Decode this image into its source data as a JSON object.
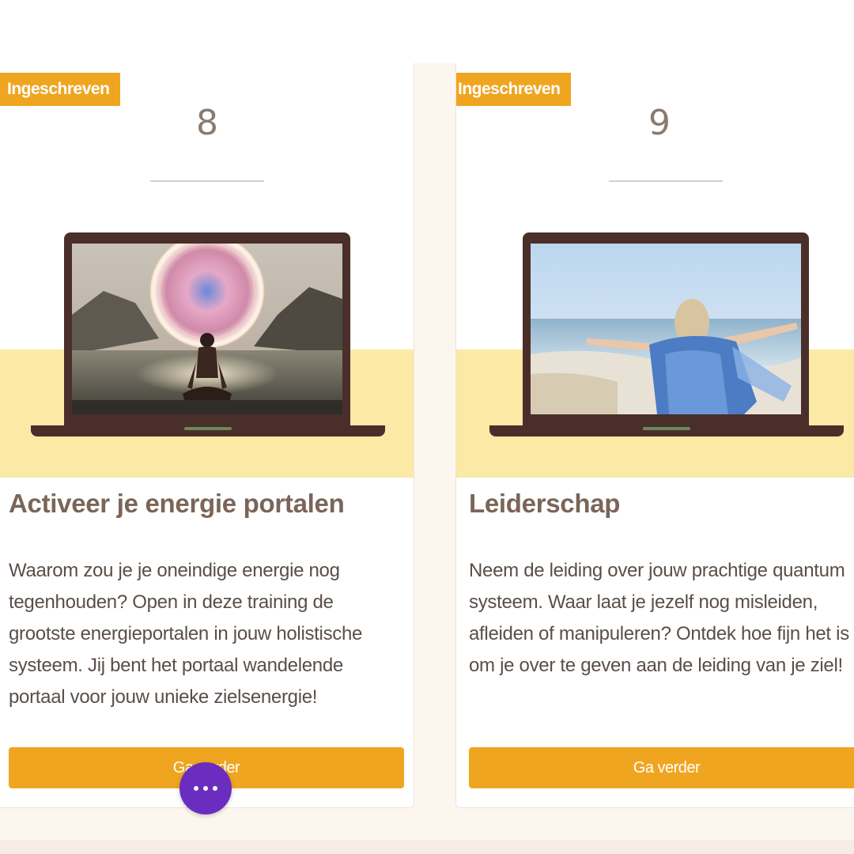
{
  "colors": {
    "accent": "#f0a520",
    "band": "#fbe9a6",
    "fab": "#6b2cc0",
    "title_text": "#7a6558"
  },
  "cards": [
    {
      "badge": "Ingeschreven",
      "number": "8",
      "image": "meditation-energy-portal-image",
      "title": "Activeer je energie portalen",
      "description": "Waarom zou je je oneindige energie nog tegenhouden? Open in deze training de grootste energieportalen in jouw holistische systeem. Jij bent het portaal wandelende portaal voor jouw unieke zielsenergie!",
      "button": "Ga verder"
    },
    {
      "badge": "Ingeschreven",
      "number": "9",
      "image": "woman-beach-open-arms-image",
      "title": "Leiderschap",
      "description": "Neem de leiding over jouw prachtige quantum systeem. Waar laat je jezelf nog misleiden, afleiden of manipuleren? Ontdek hoe fijn het is om je over te geven aan de leiding van je ziel!",
      "button": "Ga verder"
    }
  ],
  "fab": {
    "icon": "more-dots-icon"
  }
}
